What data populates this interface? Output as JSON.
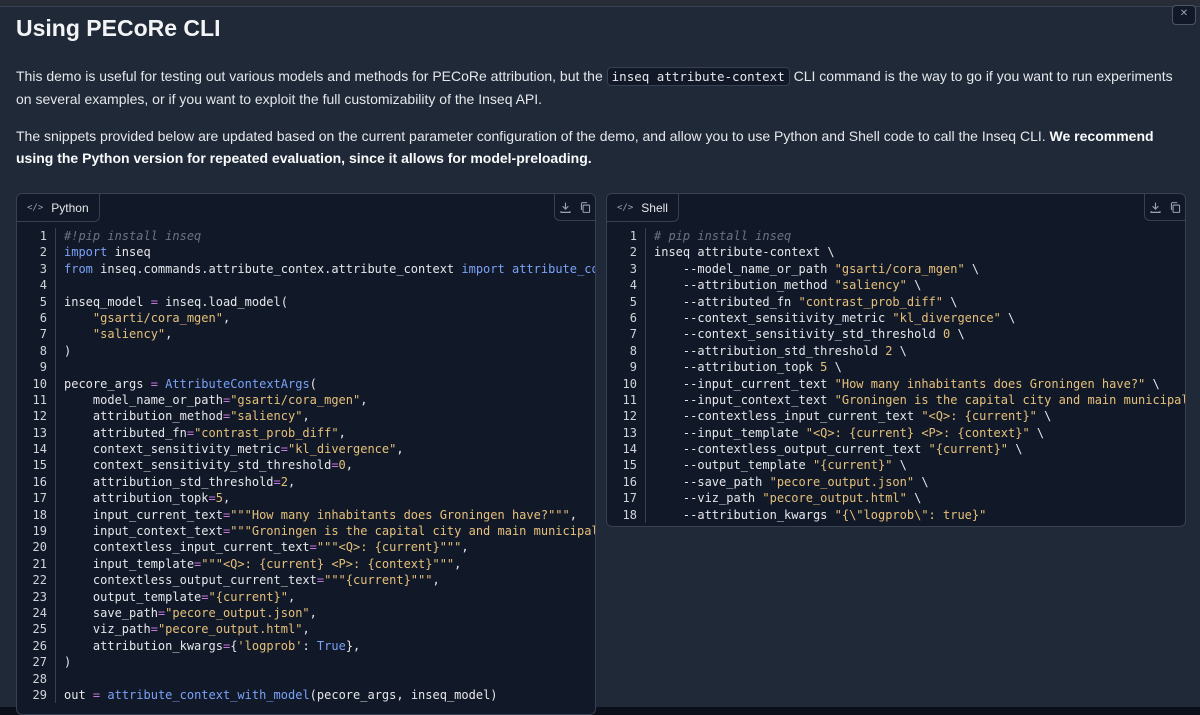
{
  "title": "Using PECoRe CLI",
  "intro": {
    "before_code": "This demo is useful for testing out various models and methods for PECoRe attribution, but the ",
    "inline_code": "inseq attribute-context",
    "after_code": " CLI command is the way to go if you want to run experiments on several examples, or if you want to exploit the full customizability of the Inseq API."
  },
  "snippet_note": {
    "plain": "The snippets provided below are updated based on the current parameter configuration of the demo, and allow you to use Python and Shell code to call the Inseq CLI. ",
    "bold": "We recommend using the Python version for repeated evaluation, since it allows for model-preloading."
  },
  "python_block": {
    "language": "Python",
    "lang_icon": "code-icon",
    "actions": [
      "download-icon",
      "copy-icon"
    ],
    "lines": [
      "#!pip install inseq",
      "import inseq",
      "from inseq.commands.attribute_contex.attribute_context import attribute_context_with_model, AttributeContextArgs",
      "",
      "inseq_model = inseq.load_model(",
      "    \"gsarti/cora_mgen\",",
      "    \"saliency\",",
      ")",
      "",
      "pecore_args = AttributeContextArgs(",
      "    model_name_or_path=\"gsarti/cora_mgen\",",
      "    attribution_method=\"saliency\",",
      "    attributed_fn=\"contrast_prob_diff\",",
      "    context_sensitivity_metric=\"kl_divergence\",",
      "    context_sensitivity_std_threshold=0,",
      "    attribution_std_threshold=2,",
      "    attribution_topk=5,",
      "    input_current_text=\"\"\"How many inhabitants does Groningen have?\"\"\",",
      "    input_context_text=\"\"\"Groningen is the capital city and main municipality",
      "    contextless_input_current_text=\"\"\"<Q>: {current}\"\"\",",
      "    input_template=\"\"\"<Q>: {current} <P>: {context}\"\"\",",
      "    contextless_output_current_text=\"\"\"{current}\"\"\",",
      "    output_template=\"{current}\",",
      "    save_path=\"pecore_output.json\",",
      "    viz_path=\"pecore_output.html\",",
      "    attribution_kwargs={'logprob': True},",
      ")",
      "",
      "out = attribute_context_with_model(pecore_args, inseq_model)"
    ]
  },
  "shell_block": {
    "language": "Shell",
    "lang_icon": "code-icon",
    "actions": [
      "download-icon",
      "copy-icon"
    ],
    "lines": [
      "# pip install inseq",
      "inseq attribute-context \\",
      "    --model_name_or_path \"gsarti/cora_mgen\" \\",
      "    --attribution_method \"saliency\" \\",
      "    --attributed_fn \"contrast_prob_diff\" \\",
      "    --context_sensitivity_metric \"kl_divergence\" \\",
      "    --context_sensitivity_std_threshold 0 \\",
      "    --attribution_std_threshold 2 \\",
      "    --attribution_topk 5 \\",
      "    --input_current_text \"How many inhabitants does Groningen have?\" \\",
      "    --input_context_text \"Groningen is the capital city and main municipality",
      "    --contextless_input_current_text \"<Q>: {current}\" \\",
      "    --input_template \"<Q>: {current} <P>: {context}\" \\",
      "    --contextless_output_current_text \"{current}\" \\",
      "    --output_template \"{current}\" \\",
      "    --save_path \"pecore_output.json\" \\",
      "    --viz_path \"pecore_output.html\" \\",
      "    --attribution_kwargs \"{\\\"logprob\\\": true}\""
    ]
  },
  "colors": {
    "background": "#1f2937",
    "code_background": "#111827",
    "keyword": "#7aa2f7",
    "string": "#e5c07b",
    "comment": "#6b7280"
  }
}
